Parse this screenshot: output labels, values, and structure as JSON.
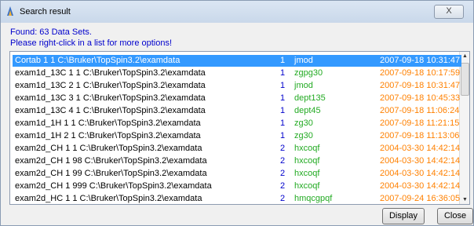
{
  "window": {
    "title": "Search result",
    "close_label": "X"
  },
  "info": {
    "found": "Found: 63 Data Sets.",
    "hint": "Please right-click in a list for more options!"
  },
  "rows": [
    {
      "name": "Cortab  1  1  C:\\Bruker\\TopSpin3.2\\examdata",
      "num": "1",
      "pulse": "jmod",
      "date": "2007-09-18 10:31:47",
      "selected": true
    },
    {
      "name": "exam1d_13C  1  1  C:\\Bruker\\TopSpin3.2\\examdata",
      "num": "1",
      "pulse": "zgpg30",
      "date": "2007-09-18 10:17:59"
    },
    {
      "name": "exam1d_13C  2  1  C:\\Bruker\\TopSpin3.2\\examdata",
      "num": "1",
      "pulse": "jmod",
      "date": "2007-09-18 10:31:47"
    },
    {
      "name": "exam1d_13C  3  1  C:\\Bruker\\TopSpin3.2\\examdata",
      "num": "1",
      "pulse": "dept135",
      "date": "2007-09-18 10:45:33"
    },
    {
      "name": "exam1d_13C  4  1  C:\\Bruker\\TopSpin3.2\\examdata",
      "num": "1",
      "pulse": "dept45",
      "date": "2007-09-18 11:06:24"
    },
    {
      "name": "exam1d_1H  1  1  C:\\Bruker\\TopSpin3.2\\examdata",
      "num": "1",
      "pulse": "zg30",
      "date": "2007-09-18 11:21:15"
    },
    {
      "name": "exam1d_1H  2  1  C:\\Bruker\\TopSpin3.2\\examdata",
      "num": "1",
      "pulse": "zg30",
      "date": "2007-09-18 11:13:06"
    },
    {
      "name": "exam2d_CH  1  1  C:\\Bruker\\TopSpin3.2\\examdata",
      "num": "2",
      "pulse": "hxcoqf",
      "date": "2004-03-30 14:42:14"
    },
    {
      "name": "exam2d_CH  1  98  C:\\Bruker\\TopSpin3.2\\examdata",
      "num": "2",
      "pulse": "hxcoqf",
      "date": "2004-03-30 14:42:14"
    },
    {
      "name": "exam2d_CH  1  99  C:\\Bruker\\TopSpin3.2\\examdata",
      "num": "2",
      "pulse": "hxcoqf",
      "date": "2004-03-30 14:42:14"
    },
    {
      "name": "exam2d_CH  1  999  C:\\Bruker\\TopSpin3.2\\examdata",
      "num": "2",
      "pulse": "hxcoqf",
      "date": "2004-03-30 14:42:14"
    },
    {
      "name": "exam2d_HC  1  1  C:\\Bruker\\TopSpin3.2\\examdata",
      "num": "2",
      "pulse": "hmqcgpqf",
      "date": "2007-09-24 16:36:05"
    }
  ],
  "buttons": {
    "display": "Display",
    "close": "Close"
  },
  "icons": {
    "window": "topspin-app-icon",
    "scroll_up": "scroll-up-arrow-icon",
    "scroll_down": "scroll-down-arrow-icon"
  }
}
